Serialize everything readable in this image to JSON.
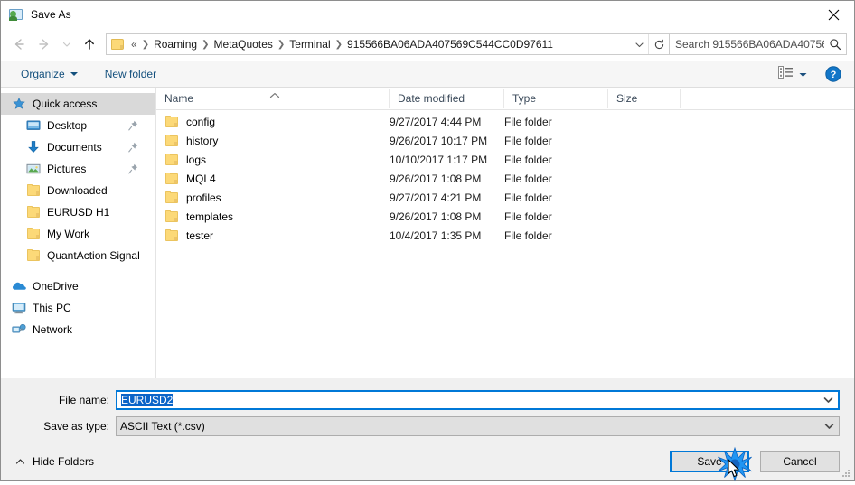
{
  "window": {
    "title": "Save As",
    "icon": "save-as-icon",
    "close_label": "✕"
  },
  "nav": {
    "back": "back-arrow",
    "forward": "forward-arrow",
    "recent": "recent-locations-chevron",
    "up": "up-arrow",
    "breadcrumbs": [
      {
        "label": "«",
        "first": true
      },
      {
        "label": "Roaming"
      },
      {
        "label": "MetaQuotes"
      },
      {
        "label": "Terminal"
      },
      {
        "label": "915566BA06ADA407569C544CC0D97611"
      }
    ],
    "dropdown_icon": "chevron-down-icon",
    "refresh_icon": "refresh-icon"
  },
  "search": {
    "placeholder": "Search 915566BA06ADA40756...",
    "icon": "search-icon"
  },
  "toolbar": {
    "organize_label": "Organize",
    "new_folder_label": "New folder",
    "view_icon": "view-mode-icon",
    "view_caret": "chevron-down-icon",
    "help_icon": "help-icon"
  },
  "sidebar": {
    "items": [
      {
        "label": "Quick access",
        "icon": "star-pin-icon",
        "selected": true,
        "level": 0,
        "pinned": false
      },
      {
        "label": "Desktop",
        "icon": "desktop-icon",
        "selected": false,
        "level": 1,
        "pinned": true
      },
      {
        "label": "Documents",
        "icon": "documents-icon",
        "selected": false,
        "level": 1,
        "pinned": true
      },
      {
        "label": "Pictures",
        "icon": "pictures-icon",
        "selected": false,
        "level": 1,
        "pinned": true
      },
      {
        "label": "Downloaded",
        "icon": "folder-icon",
        "selected": false,
        "level": 1,
        "pinned": false
      },
      {
        "label": "EURUSD H1",
        "icon": "folder-icon",
        "selected": false,
        "level": 1,
        "pinned": false
      },
      {
        "label": "My Work",
        "icon": "folder-icon",
        "selected": false,
        "level": 1,
        "pinned": false
      },
      {
        "label": "QuantAction Signal",
        "icon": "folder-icon",
        "selected": false,
        "level": 1,
        "pinned": false
      }
    ],
    "groups": [
      {
        "label": "OneDrive",
        "icon": "onedrive-icon"
      },
      {
        "label": "This PC",
        "icon": "this-pc-icon"
      },
      {
        "label": "Network",
        "icon": "network-icon"
      }
    ]
  },
  "filelist": {
    "columns": [
      "Name",
      "Date modified",
      "Type",
      "Size"
    ],
    "sort_column": "Name",
    "sort_direction": "ascending",
    "rows": [
      {
        "name": "config",
        "date": "9/27/2017 4:44 PM",
        "type": "File folder",
        "size": ""
      },
      {
        "name": "history",
        "date": "9/26/2017 10:17 PM",
        "type": "File folder",
        "size": ""
      },
      {
        "name": "logs",
        "date": "10/10/2017 1:17 PM",
        "type": "File folder",
        "size": ""
      },
      {
        "name": "MQL4",
        "date": "9/26/2017 1:08 PM",
        "type": "File folder",
        "size": ""
      },
      {
        "name": "profiles",
        "date": "9/27/2017 4:21 PM",
        "type": "File folder",
        "size": ""
      },
      {
        "name": "templates",
        "date": "9/26/2017 1:08 PM",
        "type": "File folder",
        "size": ""
      },
      {
        "name": "tester",
        "date": "10/4/2017 1:35 PM",
        "type": "File folder",
        "size": ""
      }
    ]
  },
  "form": {
    "filename_label": "File name:",
    "filename_value": "EURUSD2",
    "filetype_label": "Save as type:",
    "filetype_value": "ASCII Text (*.csv)"
  },
  "footer": {
    "hide_folders_label": "Hide Folders",
    "hide_folders_icon": "chevron-up-icon",
    "save_label": "Save",
    "cancel_label": "Cancel"
  },
  "colors": {
    "accent": "#0078d7",
    "selection": "#0a64c8",
    "toolbar_link": "#14507d",
    "folder_yellow": "#fcd978",
    "header_text": "#3b4a5a"
  }
}
